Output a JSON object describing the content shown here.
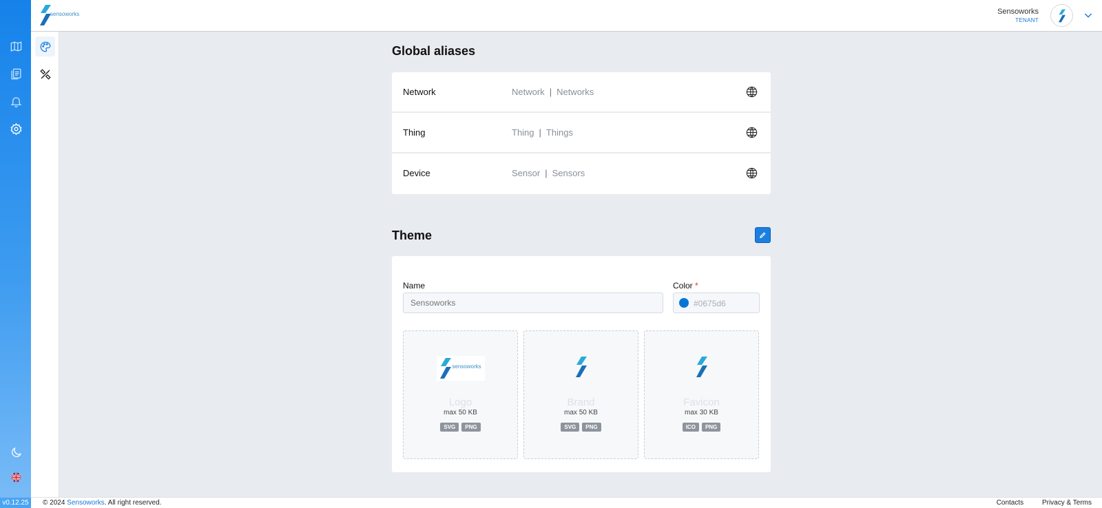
{
  "app": {
    "version": "v0.12.25"
  },
  "header": {
    "tenant_name": "Sensoworks",
    "tenant_label": "TENANT",
    "logo_wordmark": "sensoworks"
  },
  "rail": {
    "items": [
      "map-icon",
      "catalog-icon",
      "bell-icon",
      "gear-icon"
    ],
    "bottom": [
      "moon-icon",
      "uk-flag-icon"
    ]
  },
  "subnav": {
    "items": [
      "palette-icon",
      "tools-icon"
    ]
  },
  "global_aliases": {
    "title": "Global aliases",
    "rows": [
      {
        "label": "Network",
        "singular": "Network",
        "plural": "Networks",
        "separator": "|"
      },
      {
        "label": "Thing",
        "singular": "Thing",
        "plural": "Things",
        "separator": "|"
      },
      {
        "label": "Device",
        "singular": "Sensor",
        "plural": "Sensors",
        "separator": "|"
      }
    ]
  },
  "theme": {
    "title": "Theme",
    "name_label": "Name",
    "name_placeholder": "Sensoworks",
    "color_label": "Color",
    "color_required": "*",
    "color_value": "#0675d6",
    "uploads": [
      {
        "name": "Logo",
        "size": "max 50 KB",
        "formats": [
          "SVG",
          "PNG"
        ]
      },
      {
        "name": "Brand",
        "size": "max 50 KB",
        "formats": [
          "SVG",
          "PNG"
        ]
      },
      {
        "name": "Favicon",
        "size": "max 30 KB",
        "formats": [
          "ICO",
          "PNG"
        ]
      }
    ]
  },
  "footer": {
    "copyright_prefix": "© 2024 ",
    "company": "Sensoworks",
    "copyright_suffix": ". All right reserved.",
    "contacts": "Contacts",
    "privacy": "Privacy & Terms"
  },
  "colors": {
    "accent": "#1a7fe0",
    "theme_color": "#0675d6"
  }
}
